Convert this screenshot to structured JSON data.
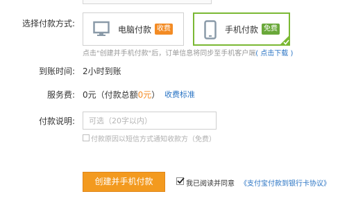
{
  "payment_method": {
    "label": "选择付款方式:",
    "options": [
      {
        "label": "电脑付款",
        "badge": "收费",
        "selected": false
      },
      {
        "label": "手机付款",
        "badge": "免费",
        "selected": true
      }
    ],
    "hint_text": "点击\"创建并手机付款\"后，订单信息将同步至手机客户端",
    "hint_link": "( 点击下载 )"
  },
  "arrival_time": {
    "label": "到账时间:",
    "value": "2小时到账"
  },
  "service_fee": {
    "label": "服务费:",
    "value_prefix": "0元（付款总额",
    "value_amount": "0元",
    "value_suffix": "）",
    "link": "收费标准"
  },
  "payment_note": {
    "label": "付款说明:",
    "placeholder": "可选（20字以内）",
    "value": ""
  },
  "sms_notify": {
    "label": "付款原因以短信方式通知收款方（免费）",
    "checked": false
  },
  "actions": {
    "create_label": "创建并手机付款",
    "agree_label": "我已阅读并同意",
    "agree_link": "《支付宝付款到银行卡协议》",
    "agree_checked": true
  },
  "colors": {
    "accent_orange": "#f39a1f",
    "selected_green": "#7ab833",
    "link_blue": "#2a74c4",
    "badge_orange": "#f38b24",
    "badge_green": "#6aa83a"
  }
}
